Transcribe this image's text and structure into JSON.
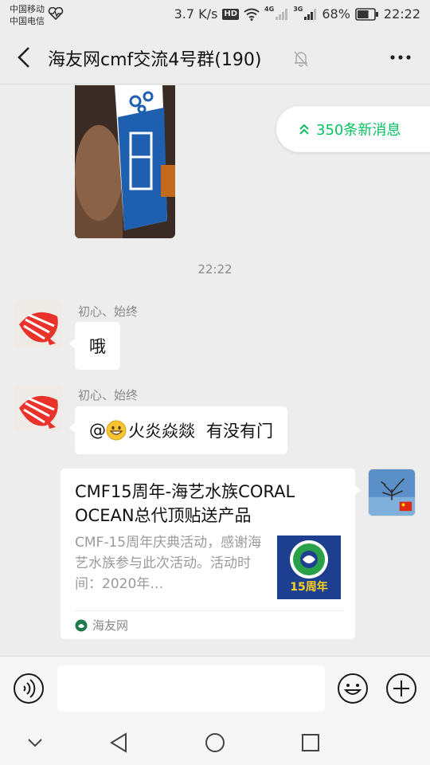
{
  "status_bar": {
    "carrier_1": "中国移动",
    "carrier_2": "中国电信",
    "net_speed": "3.7 K/s",
    "hd_badge": "HD",
    "net_type_1": "4G",
    "net_type_2": "3G",
    "battery": "68%",
    "battery_level": 0.68,
    "time": "22:22"
  },
  "header": {
    "title": "海友网cmf交流4号群(190)",
    "back_icon": "chevron-left-icon",
    "mute_icon": "bell-off-icon",
    "more_icon": "more-icon"
  },
  "new_messages_pill": {
    "label": "350条新消息",
    "icon": "double-chevron-up-icon",
    "color": "#07c160"
  },
  "timestamp": "22:22",
  "messages": [
    {
      "sender": "初心、始终",
      "text": "哦"
    },
    {
      "sender": "初心、始终",
      "mention": "@",
      "text_a": "火炎焱燚",
      "text_b": "有没有门"
    }
  ],
  "link_card": {
    "title": "CMF15周年-海艺水族CORAL OCEAN总代顶贴送产品",
    "description": "CMF-15周年庆典活动，感谢海艺水族参与此次活动。活动时间：2020年…",
    "thumb_label": "15周年",
    "source": "海友网"
  },
  "input_bar": {
    "placeholder": ""
  },
  "colors": {
    "background": "#ededed",
    "accent": "#07c160",
    "bubble": "#ffffff"
  }
}
